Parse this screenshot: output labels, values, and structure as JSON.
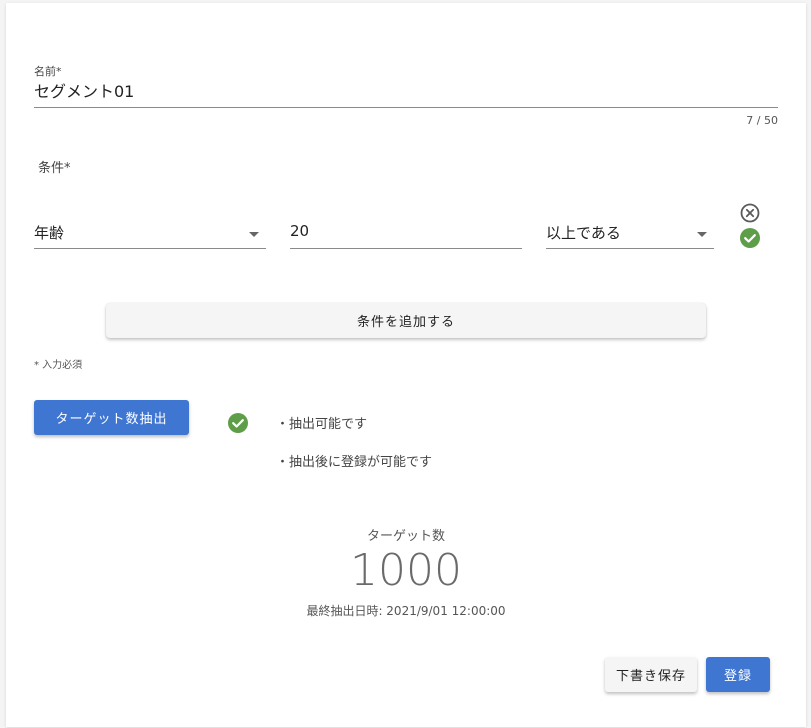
{
  "form": {
    "name_label": "名前*",
    "name_value": "セグメント01",
    "name_counter": "7 / 50",
    "conditions_label": "条件*",
    "condition": {
      "attribute": "年齢",
      "value": "20",
      "operator": "以上である"
    },
    "add_condition_label": "条件を追加する",
    "required_note": "* 入力必須"
  },
  "extraction": {
    "button_label": "ターゲット数抽出",
    "messages": [
      "・抽出可能です",
      "・抽出後に登録が可能です"
    ],
    "status_color": "#5f9e49"
  },
  "result": {
    "target_label": "ターゲット数",
    "target_count": "1000",
    "last_extracted": "最終抽出日時: 2021/9/01 12:00:00"
  },
  "actions": {
    "draft_label": "下書き保存",
    "register_label": "登録"
  },
  "colors": {
    "primary": "#3f76d2",
    "success": "#5f9e49"
  },
  "icons": {
    "remove_condition": "close-circle-icon",
    "condition_valid": "check-circle-icon",
    "extract_status": "check-circle-icon"
  }
}
